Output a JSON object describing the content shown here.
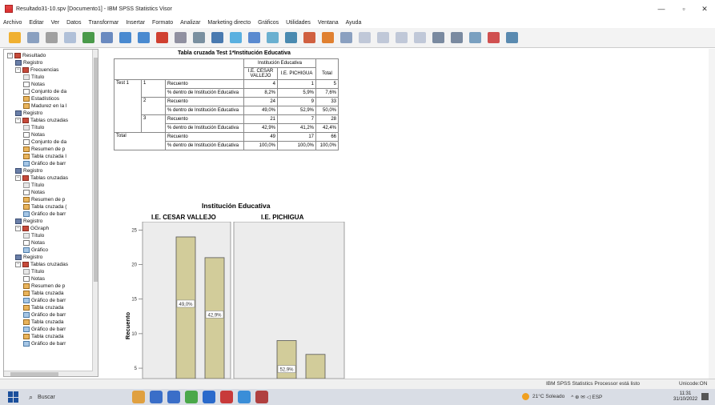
{
  "window": {
    "title": "Resultado31-10.spv [Documento1] - IBM SPSS Statistics Visor",
    "minimize": "—",
    "maximize": "▫",
    "close": "✕"
  },
  "menu": [
    "Archivo",
    "Editar",
    "Ver",
    "Datos",
    "Transformar",
    "Insertar",
    "Formato",
    "Analizar",
    "Marketing directo",
    "Gráficos",
    "Utilidades",
    "Ventana",
    "Ayuda"
  ],
  "toolbar_colors": [
    "#f0b030",
    "#8aa0c0",
    "#a0a0a0",
    "#b0c0d8",
    "#4a9a4a",
    "#6a8ac0",
    "#4a8ad0",
    "#4a8ad0",
    "#d04030",
    "#9090a0",
    "#7a90a0",
    "#4a7ab0",
    "#5ab0e0",
    "#5a8ad0",
    "#6ab0d0",
    "#4a8ab0",
    "#d06040",
    "#e08030",
    "#8aa0c0",
    "#c0c8d8",
    "#c0c8d8",
    "#c0c8d8",
    "#c0c8d8",
    "#7a8aa0",
    "#7a8aa0",
    "#7aa0c0",
    "#d05050",
    "#5a8ab0"
  ],
  "nav": {
    "items": [
      {
        "label": "Resultado",
        "icon": "book",
        "indent": 0,
        "expander": "−"
      },
      {
        "label": "Registro",
        "icon": "log",
        "indent": 1,
        "expander": ""
      },
      {
        "label": "Frecuencias",
        "icon": "book",
        "indent": 1,
        "expander": "−"
      },
      {
        "label": "Título",
        "icon": "title",
        "indent": 2,
        "expander": ""
      },
      {
        "label": "Notas",
        "icon": "notes",
        "indent": 2,
        "expander": ""
      },
      {
        "label": "Conjunto de da",
        "icon": "notes",
        "indent": 2,
        "expander": ""
      },
      {
        "label": "Estadísticos",
        "icon": "table",
        "indent": 2,
        "expander": ""
      },
      {
        "label": "Madurez en la l",
        "icon": "table",
        "indent": 2,
        "expander": ""
      },
      {
        "label": "Registro",
        "icon": "log",
        "indent": 1,
        "expander": ""
      },
      {
        "label": "Tablas cruzadas",
        "icon": "book",
        "indent": 1,
        "expander": "−"
      },
      {
        "label": "Título",
        "icon": "title",
        "indent": 2,
        "expander": ""
      },
      {
        "label": "Notas",
        "icon": "notes",
        "indent": 2,
        "expander": ""
      },
      {
        "label": "Conjunto de da",
        "icon": "notes",
        "indent": 2,
        "expander": ""
      },
      {
        "label": "Resumen de p",
        "icon": "table",
        "indent": 2,
        "expander": ""
      },
      {
        "label": "Tabla cruzada I",
        "icon": "table",
        "indent": 2,
        "expander": ""
      },
      {
        "label": "Gráfico de barr",
        "icon": "chart",
        "indent": 2,
        "expander": ""
      },
      {
        "label": "Registro",
        "icon": "log",
        "indent": 1,
        "expander": ""
      },
      {
        "label": "Tablas cruzadas",
        "icon": "book",
        "indent": 1,
        "expander": "−"
      },
      {
        "label": "Título",
        "icon": "title",
        "indent": 2,
        "expander": ""
      },
      {
        "label": "Notas",
        "icon": "notes",
        "indent": 2,
        "expander": ""
      },
      {
        "label": "Resumen de p",
        "icon": "table",
        "indent": 2,
        "expander": ""
      },
      {
        "label": "Tabla cruzada (",
        "icon": "table",
        "indent": 2,
        "expander": ""
      },
      {
        "label": "Gráfico de barr",
        "icon": "chart",
        "indent": 2,
        "expander": ""
      },
      {
        "label": "Registro",
        "icon": "log",
        "indent": 1,
        "expander": ""
      },
      {
        "label": "GGraph",
        "icon": "book",
        "indent": 1,
        "expander": "−"
      },
      {
        "label": "Título",
        "icon": "title",
        "indent": 2,
        "expander": ""
      },
      {
        "label": "Notas",
        "icon": "notes",
        "indent": 2,
        "expander": ""
      },
      {
        "label": "Gráfico",
        "icon": "chart",
        "indent": 2,
        "expander": ""
      },
      {
        "label": "Registro",
        "icon": "log",
        "indent": 1,
        "expander": ""
      },
      {
        "label": "Tablas cruzadas",
        "icon": "book",
        "indent": 1,
        "expander": "−"
      },
      {
        "label": "Título",
        "icon": "title",
        "indent": 2,
        "expander": ""
      },
      {
        "label": "Notas",
        "icon": "notes",
        "indent": 2,
        "expander": ""
      },
      {
        "label": "Resumen de p",
        "icon": "table",
        "indent": 2,
        "expander": ""
      },
      {
        "label": "Tabla cruzada",
        "icon": "table",
        "indent": 2,
        "expander": ""
      },
      {
        "label": "Gráfico de barr",
        "icon": "chart",
        "indent": 2,
        "expander": ""
      },
      {
        "label": "Tabla cruzada",
        "icon": "table",
        "indent": 2,
        "expander": ""
      },
      {
        "label": "Gráfico de barr",
        "icon": "chart",
        "indent": 2,
        "expander": ""
      },
      {
        "label": "Tabla cruzada",
        "icon": "table",
        "indent": 2,
        "expander": ""
      },
      {
        "label": "Gráfico de barr",
        "icon": "chart",
        "indent": 2,
        "expander": ""
      },
      {
        "label": "Tabla cruzada",
        "icon": "table",
        "indent": 2,
        "expander": ""
      },
      {
        "label": "Gráfico de barr",
        "icon": "chart",
        "indent": 2,
        "expander": ""
      }
    ]
  },
  "pivot": {
    "title": "Tabla cruzada Test 1*Institución Educativa",
    "col_group": "Institución Educativa",
    "col_a": "I.E. CESAR VALLEJO",
    "col_b": "I.E. PICHIGUA",
    "col_total": "Total",
    "row_var": "Test 1",
    "total_label": "Total",
    "count_label": "Recuento",
    "pct_label": "% dentro de Institución Educativa",
    "rows": [
      {
        "cat": "1",
        "count": [
          "4",
          "1",
          "5"
        ],
        "pct": [
          "8,2%",
          "5,9%",
          "7,6%"
        ]
      },
      {
        "cat": "2",
        "count": [
          "24",
          "9",
          "33"
        ],
        "pct": [
          "49,0%",
          "52,9%",
          "50,0%"
        ]
      },
      {
        "cat": "3",
        "count": [
          "21",
          "7",
          "28"
        ],
        "pct": [
          "42,9%",
          "41,2%",
          "42,4%"
        ]
      }
    ],
    "total": {
      "count": [
        "49",
        "17",
        "66"
      ],
      "pct": [
        "100,0%",
        "100,0%",
        "100,0%"
      ]
    }
  },
  "chart_data": {
    "type": "bar",
    "title": "Institución Educativa",
    "ylabel": "Recuento",
    "yticks": [
      "25",
      "20",
      "15",
      "10",
      "5"
    ],
    "ylim": [
      3.5,
      26.2
    ],
    "bar_color": "#d2cc9a",
    "panels": [
      {
        "name": "I.E. CESAR VALLEJO",
        "values": [
          24,
          21
        ],
        "labels": [
          "49,0%",
          "42,9%"
        ]
      },
      {
        "name": "I.E. PICHIGUA",
        "values": [
          9,
          7
        ],
        "labels": [
          "52,9%",
          ""
        ]
      }
    ]
  },
  "status": {
    "processor": "IBM SPSS Statistics Processor está listo",
    "unicode": "Unicode:ON"
  },
  "taskbar": {
    "search_placeholder": "Buscar",
    "weather": "21°C Soleado",
    "tray": "^ ⊕ ✉ ◁ ESP",
    "time": "11:31",
    "date": "31/10/2022",
    "app_colors": [
      "#e0a040",
      "#3a6ec8",
      "#3a6ec8",
      "#4aa84a",
      "#2a6acb",
      "#c83a3a",
      "#3a8ed8",
      "#b04040"
    ]
  }
}
